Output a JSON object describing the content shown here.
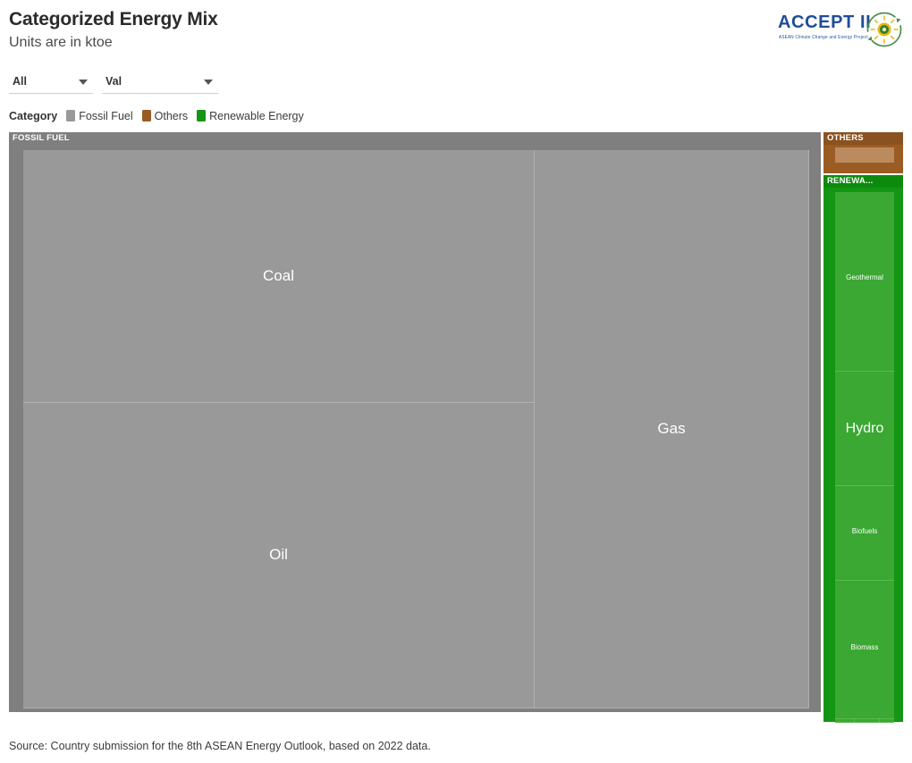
{
  "header": {
    "title": "Categorized Energy Mix",
    "subtitle": "Units are in ktoe"
  },
  "logo": {
    "text": "ACCEPT II",
    "subtitle": "ASEAN Climate Change and Energy Project",
    "mark_icon": "circular-recycle-sun-icon",
    "color": "#1f4e96",
    "mark_color": "#4a8f4a"
  },
  "filters": [
    {
      "name": "country-filter",
      "value": "All",
      "caret_icon": "chevron-down-icon"
    },
    {
      "name": "value-filter",
      "value": "Val",
      "caret_icon": "chevron-down-icon"
    }
  ],
  "legend": {
    "title": "Category",
    "items": [
      {
        "label": "Fossil Fuel",
        "color": "#999999"
      },
      {
        "label": "Others",
        "color": "#9a5c22"
      },
      {
        "label": "Renewable Energy",
        "color": "#149614"
      }
    ]
  },
  "footer": {
    "source": "Source: Country submission for the 8th ASEAN Energy Outlook, based on 2022 data."
  },
  "chart_data": {
    "type": "treemap",
    "title": "Categorized Energy Mix",
    "subtitle": "Units are in ktoe",
    "unit": "ktoe",
    "groups": [
      {
        "name": "Fossil Fuel",
        "header_label": "FOSSIL FUEL",
        "color": "#999999",
        "header_color": "#7f7f7f",
        "tiles": [
          {
            "label": "Coal",
            "area_share": 0.329
          },
          {
            "label": "Oil",
            "area_share": 0.329
          },
          {
            "label": "Gas",
            "area_share": 0.342
          }
        ]
      },
      {
        "name": "Others",
        "header_label": "OTHERS",
        "color": "#9a5c22",
        "header_color": "#8a5220",
        "tiles": [
          {
            "label": "",
            "area_share": 1.0
          }
        ]
      },
      {
        "name": "Renewable Energy",
        "header_label": "RENEWA...",
        "color": "#149614",
        "header_color": "#0d8a0d",
        "tiles": [
          {
            "label": "Geothermal",
            "area_share": 0.335
          },
          {
            "label": "Hydro",
            "area_share": 0.213
          },
          {
            "label": "Biofuels",
            "area_share": 0.176
          },
          {
            "label": "Biomass",
            "area_share": 0.258
          },
          {
            "label": "",
            "area_share": 0.006
          },
          {
            "label": "",
            "area_share": 0.006
          },
          {
            "label": "",
            "area_share": 0.006
          }
        ]
      }
    ]
  }
}
